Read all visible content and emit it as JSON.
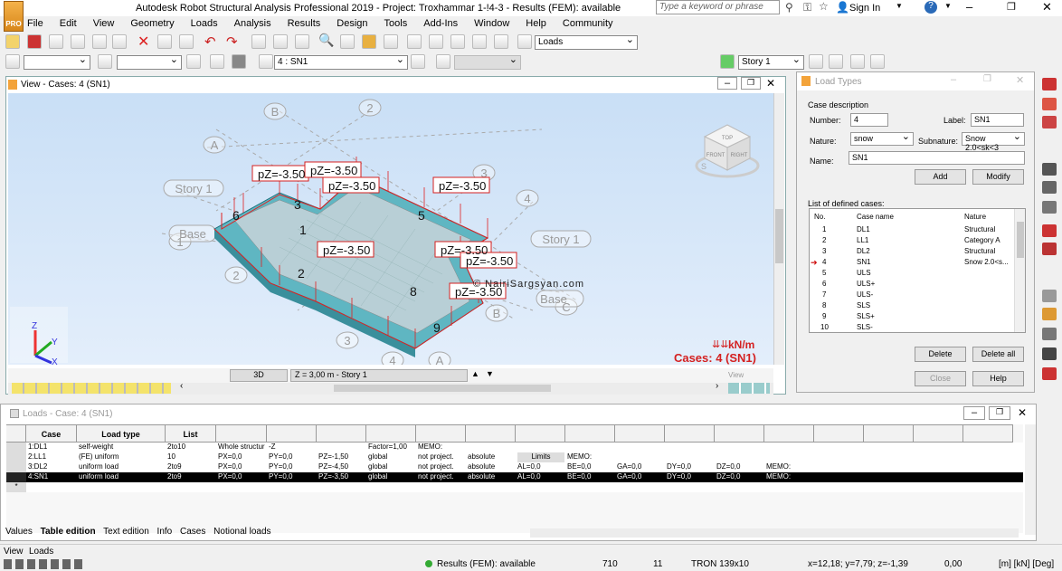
{
  "app": {
    "title": "Autodesk Robot Structural Analysis Professional 2019 - Project: Troxhammar 1-!4-3 - Results (FEM): available",
    "search_placeholder": "Type a keyword or phrase",
    "sign_in": "Sign In",
    "icon_label": "PRO"
  },
  "menu": [
    "File",
    "Edit",
    "View",
    "Geometry",
    "Loads",
    "Analysis",
    "Results",
    "Design",
    "Tools",
    "Add-Ins",
    "Window",
    "Help",
    "Community"
  ],
  "toolbar": {
    "loads_combo": "Loads",
    "case_combo": "4 : SN1",
    "story_combo": "Story 1"
  },
  "view": {
    "title": "View - Cases: 4 (SN1)",
    "mode": "3D",
    "level": "Z = 3,00 m - Story 1",
    "unit": "kN/m",
    "cases": "Cases: 4 (SN1)",
    "watermark": "© NairiSargsyan.com",
    "axes": {
      "x": "X",
      "y": "Y",
      "z": "Z"
    },
    "tab": "View",
    "viewcube": {
      "top": "TOP",
      "front": "FRONT",
      "right": "RIGHT",
      "compass": "S"
    },
    "loads": [
      "pZ=-3.50",
      "pZ=-3.50",
      "pZ=-3.50",
      "pZ=-3.50",
      "pZ=-3.50",
      "pZ=-3.50",
      "pZ=-3.50",
      "pZ=-3.50"
    ],
    "grid_labels": [
      "A",
      "B",
      "2",
      "3",
      "4",
      "Story 1",
      "Base",
      "1",
      "2",
      "3",
      "4",
      "A",
      "B",
      "C",
      "Story 1",
      "Base"
    ],
    "panel_numbers": [
      "6",
      "3",
      "1",
      "2",
      "5",
      "8",
      "9"
    ]
  },
  "loadtypes": {
    "title": "Load Types",
    "section": "Case description",
    "number_label": "Number:",
    "number": "4",
    "label_label": "Label:",
    "label": "SN1",
    "nature_label": "Nature:",
    "nature": "snow",
    "subnature_label": "Subnature:",
    "subnature": "Snow 2.0<sk<3",
    "name_label": "Name:",
    "name": "SN1",
    "add": "Add",
    "modify": "Modify",
    "list_title": "List of defined cases:",
    "cols": [
      "No.",
      "Case name",
      "Nature"
    ],
    "rows": [
      [
        "1",
        "DL1",
        "Structural"
      ],
      [
        "2",
        "LL1",
        "Category A"
      ],
      [
        "3",
        "DL2",
        "Structural"
      ],
      [
        "4",
        "SN1",
        "Snow 2.0<s..."
      ],
      [
        "5",
        "ULS",
        ""
      ],
      [
        "6",
        "ULS+",
        ""
      ],
      [
        "7",
        "ULS-",
        ""
      ],
      [
        "8",
        "SLS",
        ""
      ],
      [
        "9",
        "SLS+",
        ""
      ],
      [
        "10",
        "SLS-",
        ""
      ]
    ],
    "delete": "Delete",
    "delete_all": "Delete all",
    "close": "Close",
    "help": "Help"
  },
  "loads": {
    "title": "Loads - Case: 4 (SN1)",
    "headers": [
      "Case",
      "Load type",
      "List",
      "",
      "",
      "",
      "",
      "",
      "",
      "",
      "",
      "",
      "",
      "",
      "",
      "",
      "",
      "",
      ""
    ],
    "rows": [
      [
        "1:DL1",
        "self-weight",
        "2to10",
        "Whole structur",
        "-Z",
        "",
        "Factor=1,00",
        "MEMO:",
        "",
        "",
        "",
        "",
        "",
        "",
        "",
        "",
        "",
        "",
        ""
      ],
      [
        "2:LL1",
        "(FE) uniform",
        "10",
        "PX=0,0",
        "PY=0,0",
        "PZ=-1,50",
        "global",
        "not project.",
        "absolute",
        "Limits",
        "MEMO:",
        "",
        "",
        "",
        "",
        "",
        "",
        "",
        ""
      ],
      [
        "3:DL2",
        "uniform load",
        "2to9",
        "PX=0,0",
        "PY=0,0",
        "PZ=-4,50",
        "global",
        "not project.",
        "absolute",
        "AL=0,0",
        "BE=0,0",
        "GA=0,0",
        "DY=0,0",
        "DZ=0,0",
        "MEMO:",
        "",
        "",
        "",
        ""
      ],
      [
        "4:SN1",
        "uniform load",
        "2to9",
        "PX=0,0",
        "PY=0,0",
        "PZ=-3,50",
        "global",
        "not project.",
        "absolute",
        "AL=0,0",
        "BE=0,0",
        "GA=0,0",
        "DY=0,0",
        "DZ=0,0",
        "MEMO:",
        "",
        "",
        "",
        ""
      ]
    ],
    "new_row": "*",
    "tabs": [
      "Values",
      "Table edition",
      "Text edition",
      "Info",
      "Cases",
      "Notional loads"
    ]
  },
  "status": {
    "tabs": [
      "View",
      "Loads"
    ],
    "results": "Results (FEM): available",
    "n1": "710",
    "n2": "11",
    "section": "TRON 139x10",
    "coords": "x=12,18; y=7,79; z=-1,39",
    "value": "0,00",
    "units": "[m] [kN] [Deg]"
  },
  "colors": {
    "accent": "#d42020",
    "slab": "#5fb6c2",
    "canvas_top": "#c9dff6"
  }
}
